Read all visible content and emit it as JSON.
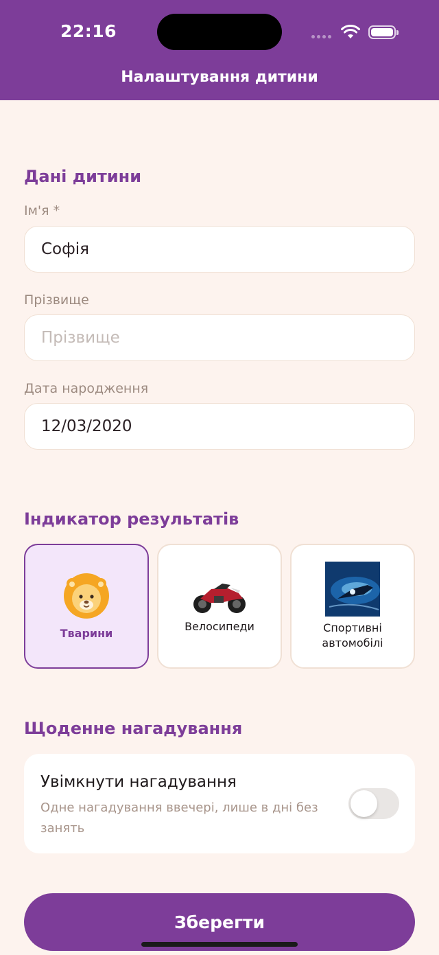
{
  "status_bar": {
    "time": "22:16"
  },
  "header": {
    "title": "Налаштування дитини"
  },
  "child_data": {
    "section_title": "Дані дитини",
    "first_name": {
      "label": "Ім'я *",
      "value": "Софія"
    },
    "last_name": {
      "label": "Прізвище",
      "value": "",
      "placeholder": "Прізвище"
    },
    "birth_date": {
      "label": "Дата народження",
      "value": "12/03/2020"
    }
  },
  "indicator": {
    "section_title": "Індикатор результатів",
    "options": [
      {
        "label": "Тварини",
        "icon": "lion-icon",
        "selected": true
      },
      {
        "label": "Велосипеди",
        "icon": "motorcycle-icon",
        "selected": false
      },
      {
        "label": "Спортивні\nавтомобілі",
        "icon": "sports-car-icon",
        "selected": false
      }
    ]
  },
  "reminder": {
    "section_title": "Щоденне нагадування",
    "title": "Увімкнути нагадування",
    "description": "Одне нагадування ввечері, лише в дні без занять",
    "enabled": false
  },
  "actions": {
    "save_label": "Зберегти"
  },
  "colors": {
    "primary": "#7d3d99",
    "background": "#fdf3ee",
    "selected_card": "#f3e6fa"
  }
}
